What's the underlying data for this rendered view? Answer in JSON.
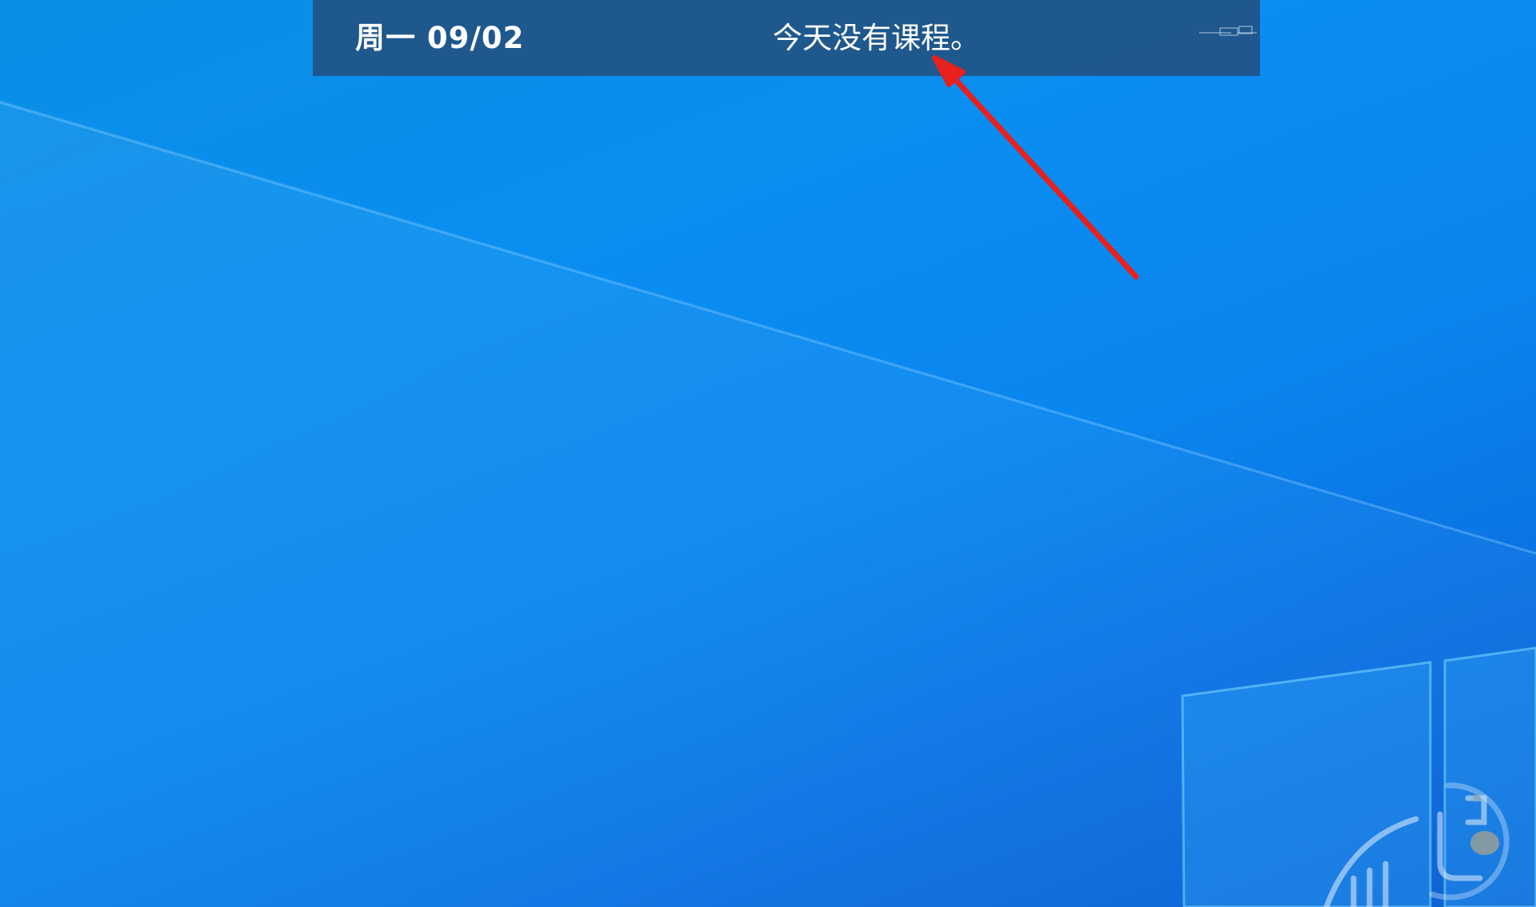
{
  "schedule_bar": {
    "date_label": "周一 09/02",
    "message": "今天没有课程。"
  },
  "icons": {
    "bar_handle": "drag-handle-icon",
    "annotation": "red-arrow-icon",
    "watermark": "circular-logo-watermark"
  },
  "colors": {
    "bar_background": "#244C78",
    "bar_text": "#FFFFFF",
    "arrow": "#E8201E",
    "desktop_accent": "#0A8EF0"
  }
}
